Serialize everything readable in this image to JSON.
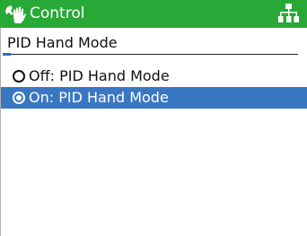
{
  "header": {
    "title": "Control",
    "left_icon": "hand-wrench-icon",
    "right_icon": "network-tree-icon"
  },
  "subheader": {
    "label": "PID Hand Mode"
  },
  "options": [
    {
      "label": "Off: PID Hand Mode",
      "selected": false
    },
    {
      "label": "On: PID Hand Mode",
      "selected": true
    }
  ],
  "colors": {
    "header_bg": "#28a836",
    "selection_bg": "#3a77c2",
    "accent": "#2e6fb8"
  }
}
